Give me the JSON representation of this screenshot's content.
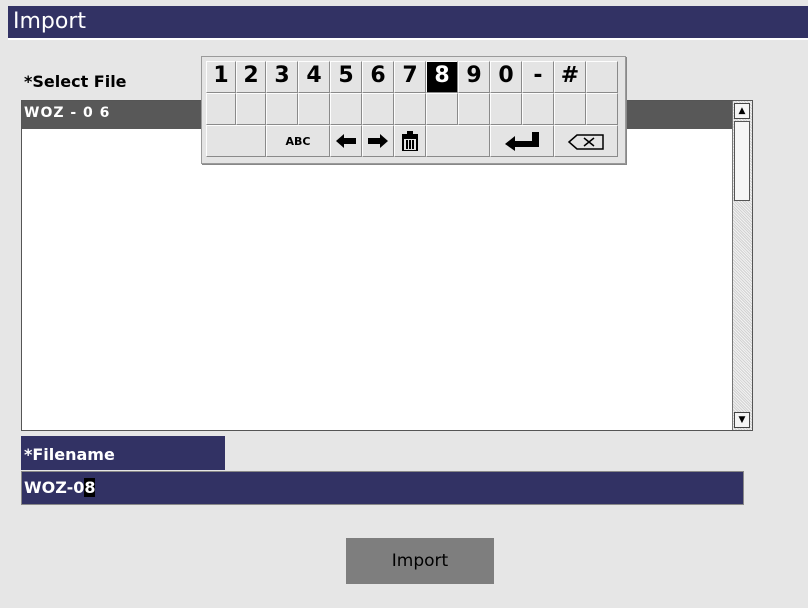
{
  "title": "Import",
  "select_label": "*Select File",
  "files": [
    "WOZ - 0 6"
  ],
  "filename_label": "*Filename",
  "filename_value": "WOZ-0",
  "filename_caret_char": "8",
  "import_label": "Import",
  "keypad": {
    "row1": [
      "1",
      "2",
      "3",
      "4",
      "5",
      "6",
      "7",
      "8",
      "9",
      "0",
      "-",
      "#",
      ""
    ],
    "selected_key": "8",
    "abc_label": "ABC",
    "icons": {
      "left": "arrow-left-icon",
      "right": "arrow-right-icon",
      "delete": "trash-icon",
      "enter": "enter-icon",
      "backspace": "backspace-icon"
    }
  },
  "colors": {
    "title_bg": "#323264",
    "field_bg": "#323264",
    "selection_bg": "#585858",
    "button_bg": "#7e7e7e"
  }
}
